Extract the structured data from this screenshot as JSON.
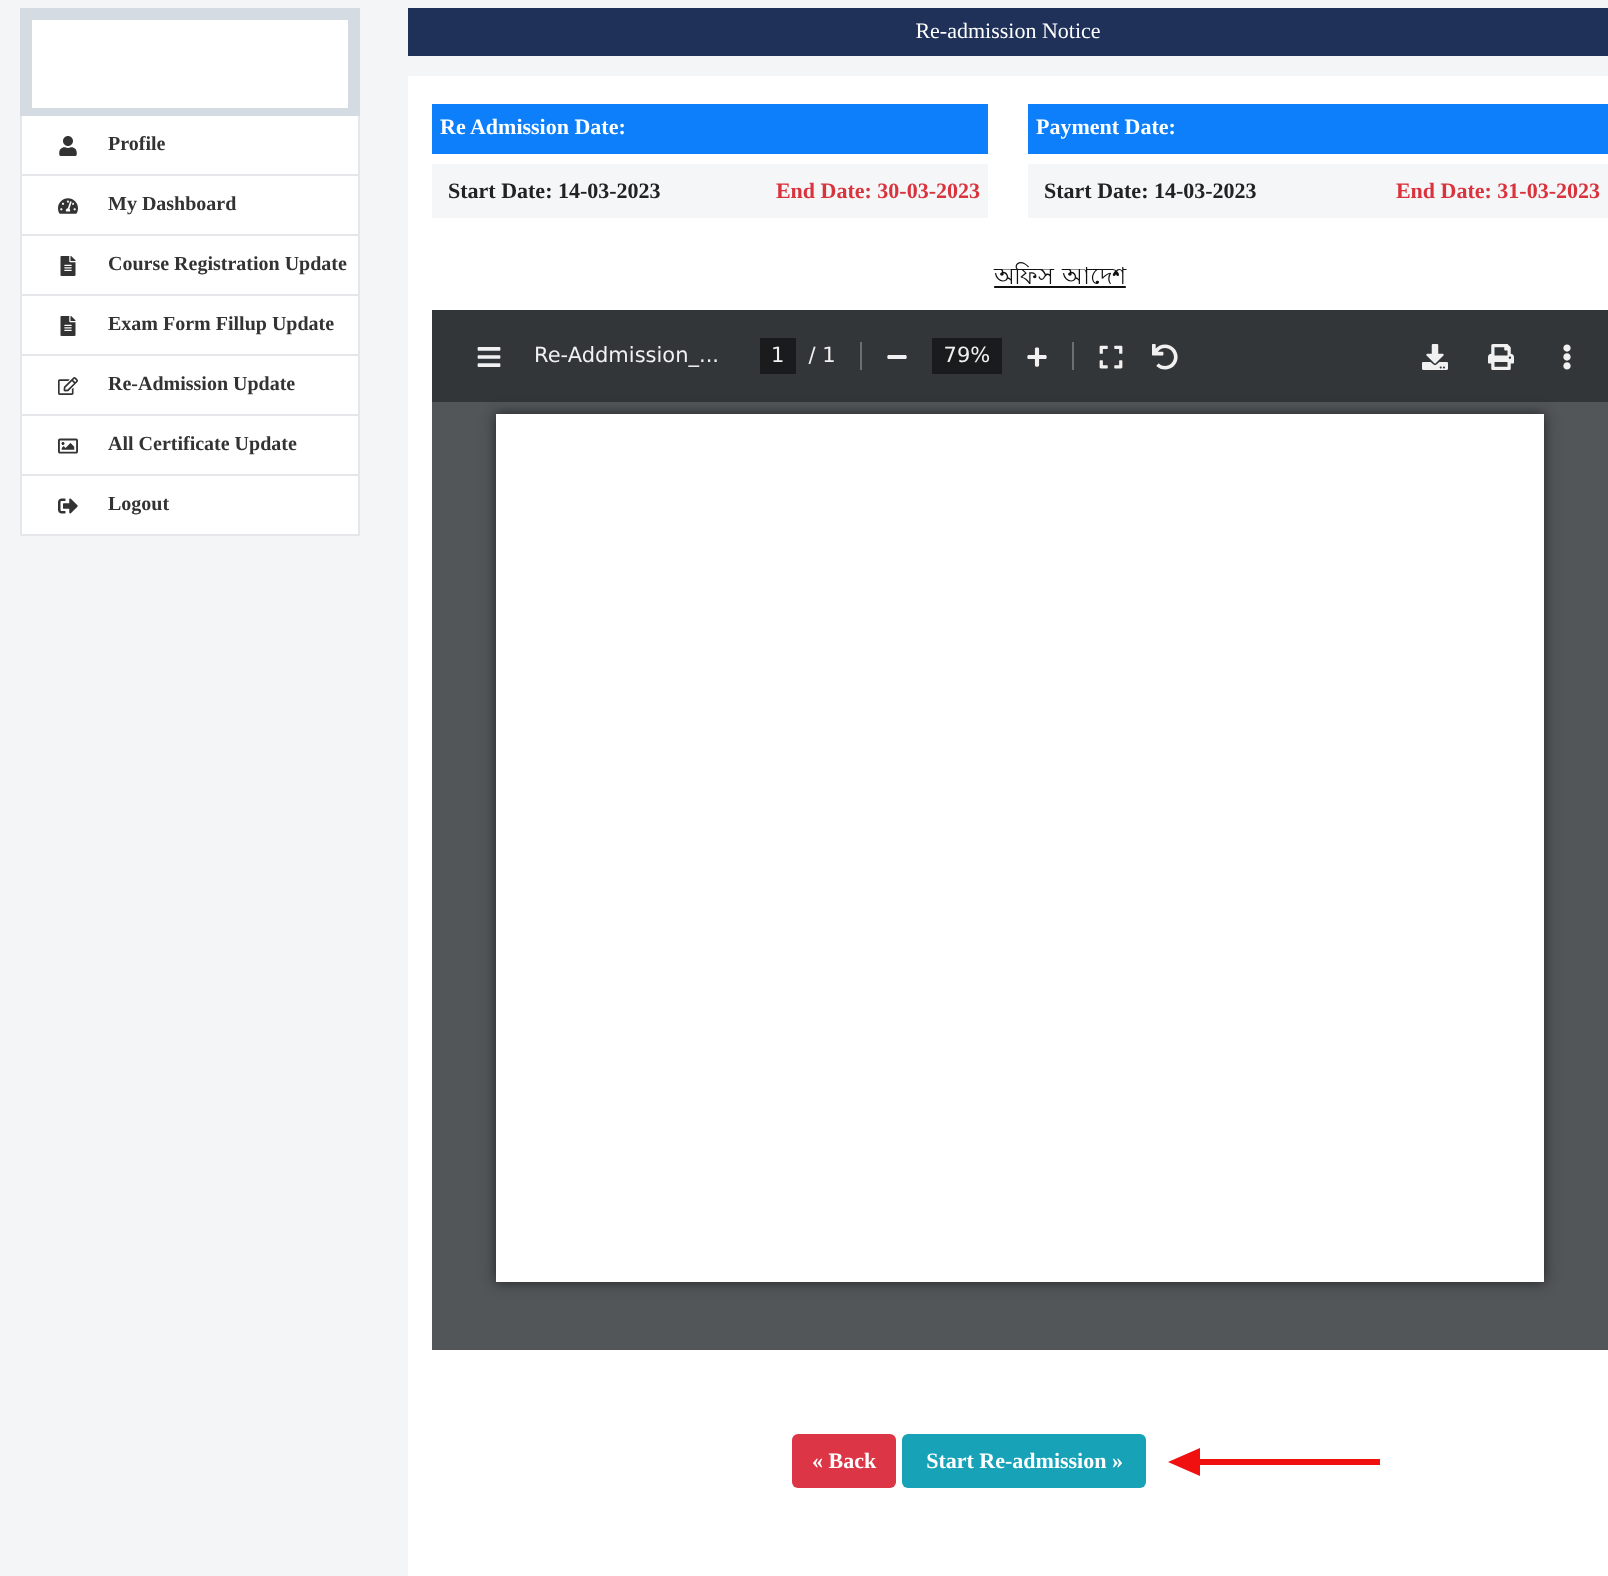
{
  "sidebar": {
    "items": [
      {
        "label": "Profile"
      },
      {
        "label": "My Dashboard"
      },
      {
        "label": "Course Registration Update"
      },
      {
        "label": "Exam Form Fillup Update"
      },
      {
        "label": "Re-Admission Update"
      },
      {
        "label": "All Certificate Update"
      },
      {
        "label": "Logout"
      }
    ]
  },
  "header": {
    "title": "Re-admission Notice"
  },
  "date_cards": [
    {
      "title": "Re Admission Date:",
      "start": "Start Date: 14-03-2023",
      "end": "End Date: 30-03-2023"
    },
    {
      "title": "Payment Date:",
      "start": "Start Date: 14-03-2023",
      "end": "End Date: 31-03-2023"
    }
  ],
  "document_title": "অফিস আদেশ",
  "pdf_viewer": {
    "file_name": "Re-Addmission_...",
    "page": "1",
    "page_total": "/ 1",
    "zoom": "79%"
  },
  "buttons": [
    {
      "kind": "back",
      "label": "« Back"
    },
    {
      "kind": "start",
      "label": "Start Re-admission »"
    }
  ]
}
